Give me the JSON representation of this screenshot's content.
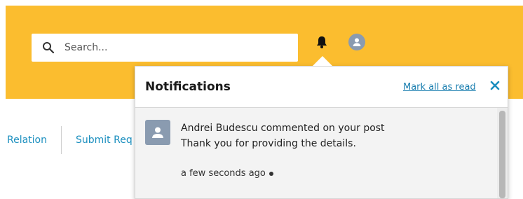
{
  "header": {
    "search": {
      "placeholder": "Search..."
    },
    "icons": {
      "search": "search-icon",
      "bell": "bell-icon",
      "user": "user-avatar-icon"
    },
    "colors": {
      "header_bg": "#fbbd2f",
      "link": "#1b8fbf"
    }
  },
  "tabs": [
    {
      "label": "Relation"
    },
    {
      "label": "Submit Req"
    }
  ],
  "notifications": {
    "title": "Notifications",
    "mark_all_label": "Mark all as read",
    "items": [
      {
        "message": "Andrei Budescu commented on your post",
        "detail": "Thank you for providing the details.",
        "time": "a few seconds ago",
        "unread": true
      }
    ]
  }
}
